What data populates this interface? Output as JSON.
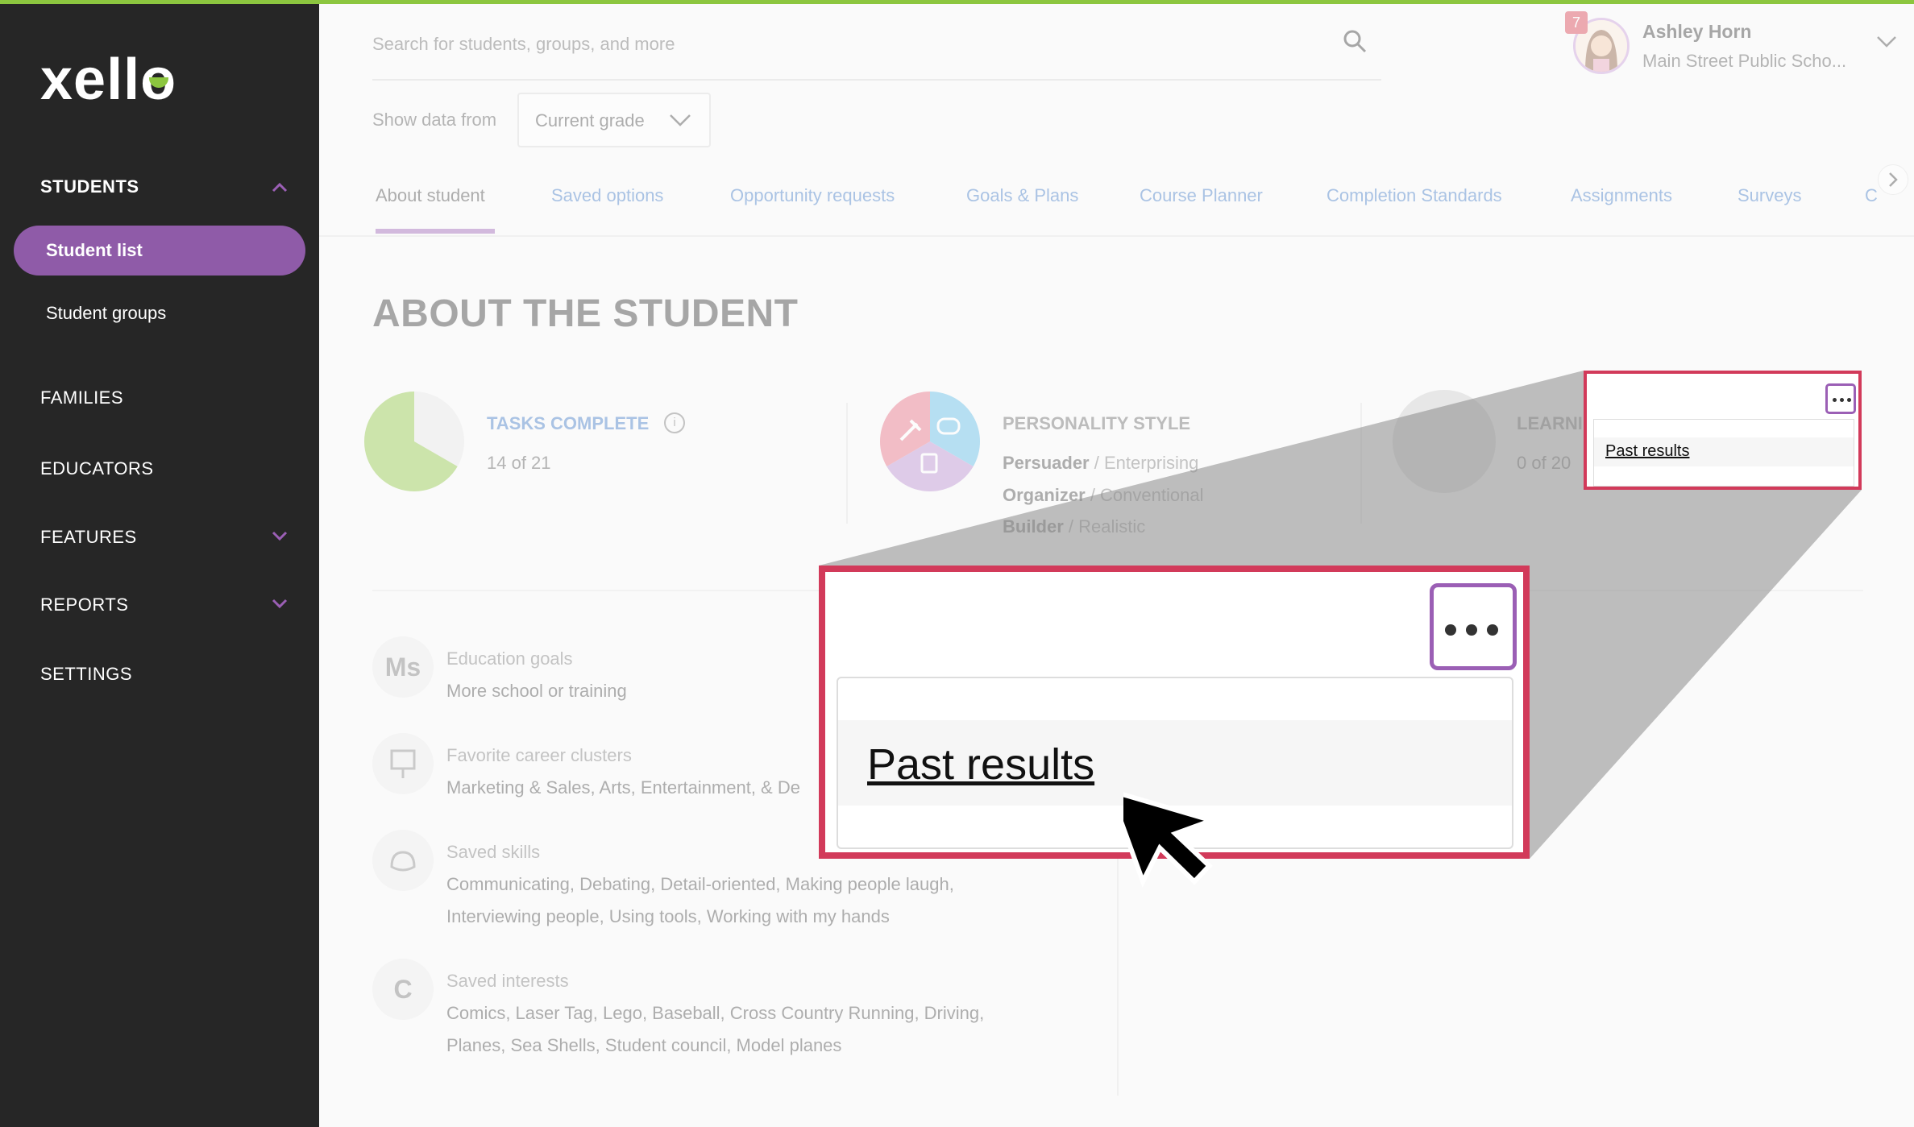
{
  "app": {
    "logo": "xell",
    "logo_last": "o"
  },
  "sidebar": {
    "students": "STUDENTS",
    "student_list": "Student list",
    "student_groups": "Student groups",
    "families": "FAMILIES",
    "educators": "EDUCATORS",
    "features": "FEATURES",
    "reports": "REPORTS",
    "settings": "SETTINGS"
  },
  "header": {
    "search_placeholder": "Search for students, groups, and more",
    "show_data_from": "Show data from",
    "grade_selected": "Current grade",
    "notifications": "7",
    "user_name": "Ashley Horn",
    "user_school": "Main Street Public Scho..."
  },
  "tabs": [
    {
      "label": "About student"
    },
    {
      "label": "Saved options"
    },
    {
      "label": "Opportunity requests"
    },
    {
      "label": "Goals & Plans"
    },
    {
      "label": "Course Planner"
    },
    {
      "label": "Completion Standards"
    },
    {
      "label": "Assignments"
    },
    {
      "label": "Surveys"
    },
    {
      "label": "C"
    }
  ],
  "page": {
    "title": "ABOUT THE STUDENT",
    "tasks_label": "TASKS COMPLETE",
    "tasks_value": "14 of 21",
    "tasks_done": 14,
    "tasks_total": 21,
    "personality_label": "PERSONALITY STYLE",
    "personality": [
      {
        "name": "Persuader",
        "type": " / Enterprising"
      },
      {
        "name": "Organizer",
        "type": " / Conventional"
      },
      {
        "name": "Builder",
        "type": " / Realistic"
      }
    ],
    "learning_label": "LEARNI",
    "learning_value": "0 of 20",
    "info": [
      {
        "icon_text": "Ms",
        "label": "Education goals",
        "value": "More school or training"
      },
      {
        "icon_text": "",
        "label": "Favorite career clusters",
        "value": "Marketing & Sales, Arts, Entertainment, & De"
      },
      {
        "icon_text": "",
        "label": "Saved skills",
        "value": "Communicating, Debating, Detail-oriented, Making people laugh,",
        "value2": "Interviewing people, Using tools, Working with my hands"
      },
      {
        "icon_text": "C",
        "label": "Saved interests",
        "value": "Comics, Laser Tag, Lego, Baseball, Cross Country Running, Driving,",
        "value2": "Planes, Sea Shells, Student council, Model planes"
      }
    ]
  },
  "menu": {
    "past_results": "Past results"
  },
  "colors": {
    "accent": "#9b5fb5",
    "highlight": "#d23a5a",
    "link": "#3c78c6",
    "pie": "#8cc63f"
  }
}
